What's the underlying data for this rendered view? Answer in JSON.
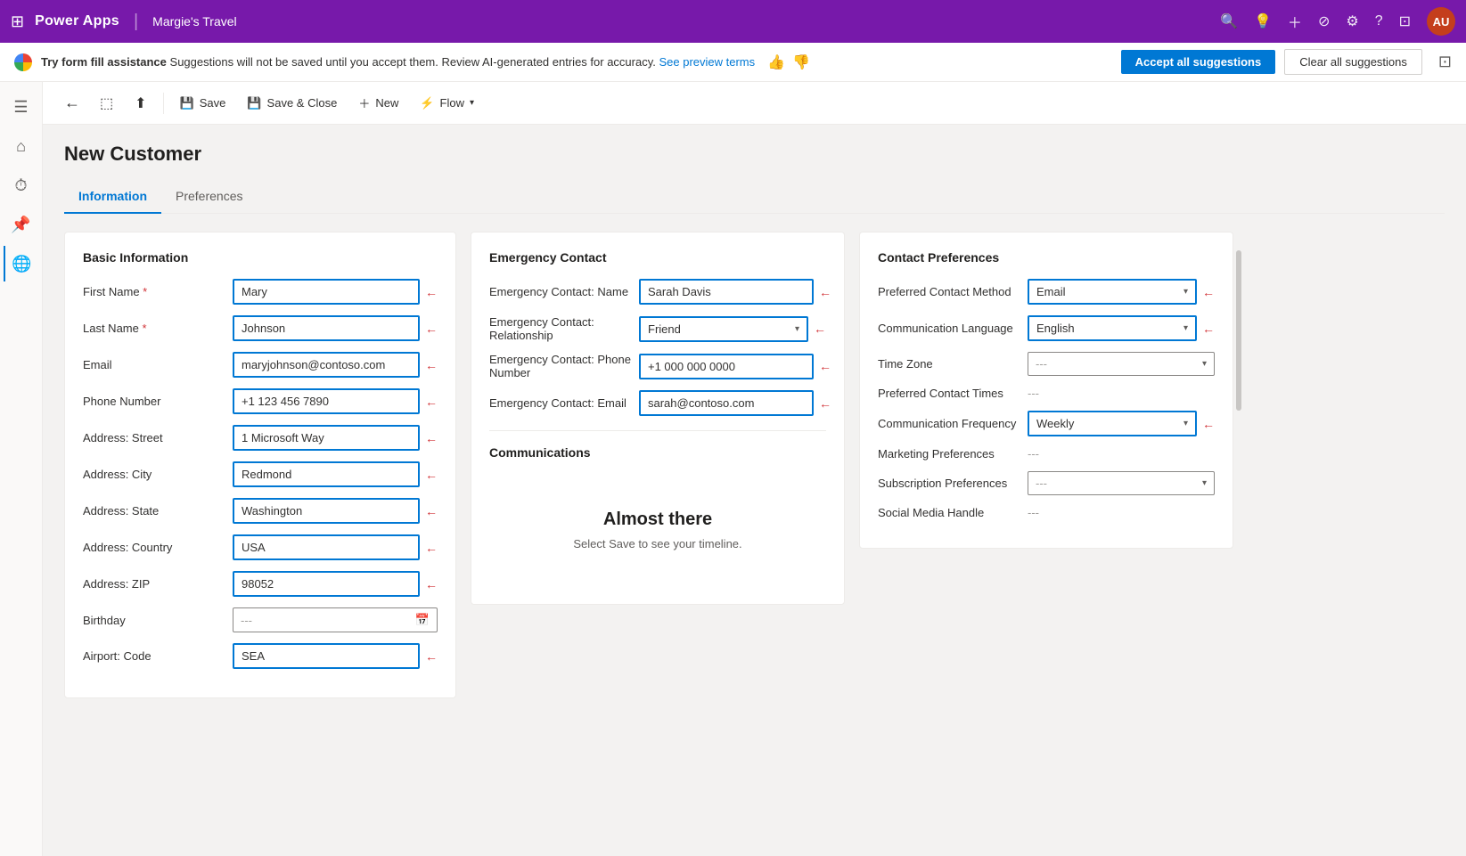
{
  "app": {
    "brand": "Power Apps",
    "separator": "|",
    "app_name": "Margie's Travel",
    "avatar_initials": "AU"
  },
  "banner": {
    "heading": "Try form fill assistance",
    "text": " Suggestions will not be saved until you accept them. Review AI-generated entries for accuracy. ",
    "link_text": "See preview terms",
    "accept_label": "Accept all suggestions",
    "clear_label": "Clear all suggestions"
  },
  "toolbar": {
    "back": "←",
    "save_label": "Save",
    "save_close_label": "Save & Close",
    "new_label": "New",
    "flow_label": "Flow"
  },
  "form": {
    "title": "New Customer",
    "tabs": [
      {
        "label": "Information",
        "active": true
      },
      {
        "label": "Preferences",
        "active": false
      }
    ]
  },
  "basic_info": {
    "section_title": "Basic Information",
    "fields": [
      {
        "label": "First Name",
        "required": true,
        "value": "Mary",
        "highlighted": true,
        "type": "input"
      },
      {
        "label": "Last Name",
        "required": true,
        "value": "Johnson",
        "highlighted": true,
        "type": "input"
      },
      {
        "label": "Email",
        "required": false,
        "value": "maryjohnson@contoso.com",
        "highlighted": true,
        "type": "input"
      },
      {
        "label": "Phone Number",
        "required": false,
        "value": "+1 123 456 7890",
        "highlighted": true,
        "type": "input"
      },
      {
        "label": "Address: Street",
        "required": false,
        "value": "1 Microsoft Way",
        "highlighted": true,
        "type": "input"
      },
      {
        "label": "Address: City",
        "required": false,
        "value": "Redmond",
        "highlighted": true,
        "type": "input"
      },
      {
        "label": "Address: State",
        "required": false,
        "value": "Washington",
        "highlighted": true,
        "type": "input"
      },
      {
        "label": "Address: Country",
        "required": false,
        "value": "USA",
        "highlighted": true,
        "type": "input"
      },
      {
        "label": "Address: ZIP",
        "required": false,
        "value": "98052",
        "highlighted": true,
        "type": "input"
      },
      {
        "label": "Birthday",
        "required": false,
        "value": "---",
        "highlighted": false,
        "type": "date"
      },
      {
        "label": "Airport: Code",
        "required": false,
        "value": "SEA",
        "highlighted": true,
        "type": "input"
      }
    ]
  },
  "emergency_contact": {
    "section_title": "Emergency Contact",
    "fields": [
      {
        "label": "Emergency Contact: Name",
        "value": "Sarah Davis",
        "highlighted": true,
        "type": "input"
      },
      {
        "label": "Emergency Contact: Relationship",
        "value": "Friend",
        "highlighted": true,
        "type": "select"
      },
      {
        "label": "Emergency Contact: Phone Number",
        "value": "+1 000 000 0000",
        "highlighted": true,
        "type": "input"
      },
      {
        "label": "Emergency Contact: Email",
        "value": "sarah@contoso.com",
        "highlighted": true,
        "type": "input"
      }
    ],
    "communications_title": "Communications",
    "almost_there": "Almost there",
    "almost_there_sub": "Select Save to see your timeline."
  },
  "contact_preferences": {
    "section_title": "Contact Preferences",
    "fields": [
      {
        "label": "Preferred Contact Method",
        "value": "Email",
        "highlighted": true,
        "type": "select"
      },
      {
        "label": "Communication Language",
        "value": "English",
        "highlighted": true,
        "type": "select"
      },
      {
        "label": "Time Zone",
        "value": "---",
        "highlighted": false,
        "type": "select"
      },
      {
        "label": "Preferred Contact Times",
        "value": "---",
        "highlighted": false,
        "type": "text"
      },
      {
        "label": "Communication Frequency",
        "value": "Weekly",
        "highlighted": true,
        "type": "select"
      },
      {
        "label": "Marketing Preferences",
        "value": "---",
        "highlighted": false,
        "type": "text"
      },
      {
        "label": "Subscription Preferences",
        "value": "---",
        "highlighted": false,
        "type": "select"
      },
      {
        "label": "Social Media Handle",
        "value": "---",
        "highlighted": false,
        "type": "text"
      }
    ]
  },
  "sidebar": {
    "icons": [
      {
        "name": "hamburger",
        "symbol": "☰",
        "active": false
      },
      {
        "name": "home",
        "symbol": "⌂",
        "active": false
      },
      {
        "name": "clock",
        "symbol": "⏱",
        "active": false
      },
      {
        "name": "pin",
        "symbol": "📌",
        "active": false
      },
      {
        "name": "globe",
        "symbol": "🌐",
        "active": true
      }
    ]
  }
}
